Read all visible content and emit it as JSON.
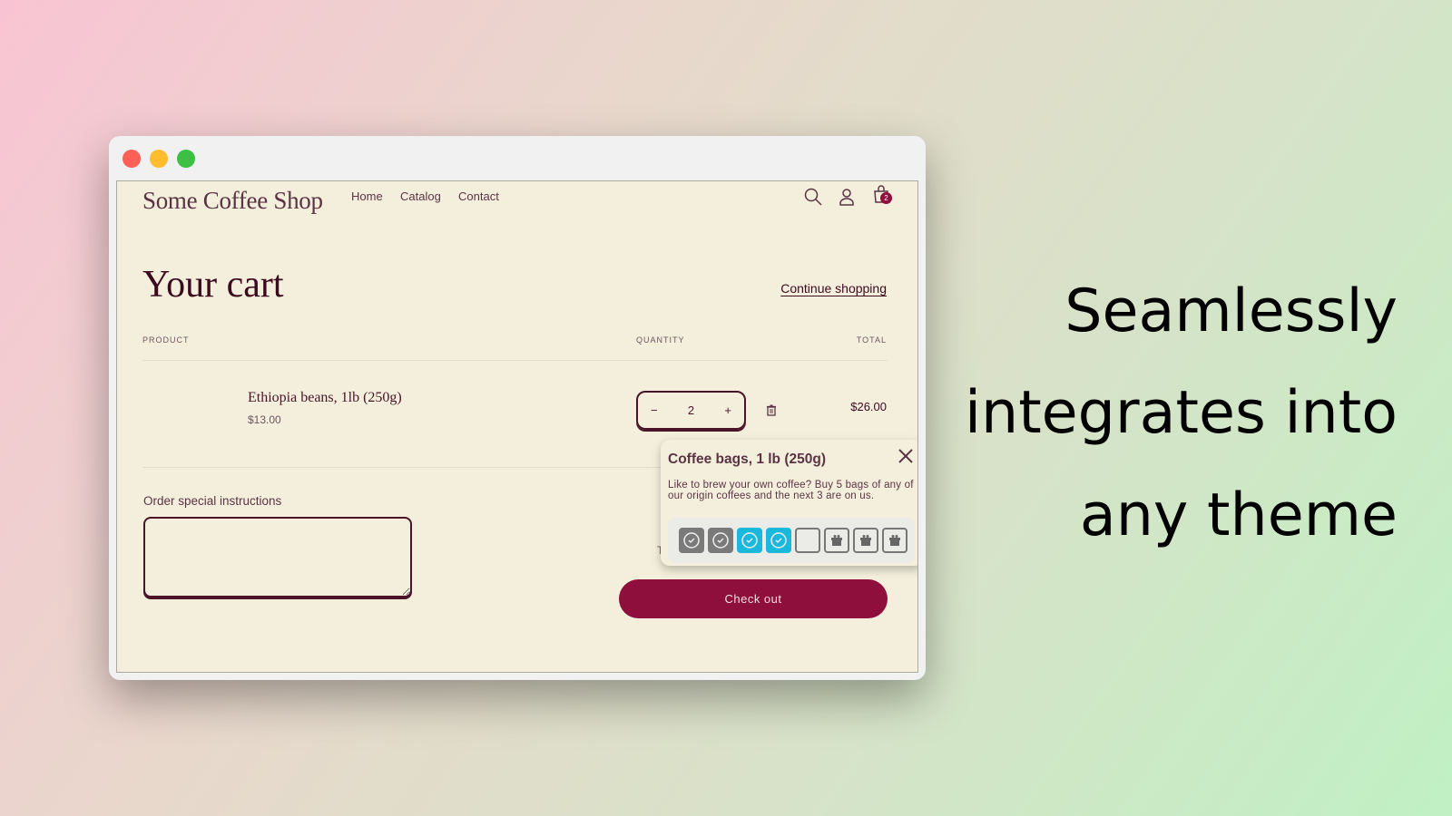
{
  "window": {
    "controls": [
      "close",
      "minimize",
      "maximize"
    ],
    "colors": {
      "close": "#fe5f57",
      "minimize": "#febc2e",
      "maximize": "#3dbf44"
    }
  },
  "header": {
    "logo": "Some Coffee Shop",
    "nav": [
      "Home",
      "Catalog",
      "Contact"
    ],
    "cart_count": "2",
    "icons": [
      "search-icon",
      "account-icon",
      "cart-icon"
    ]
  },
  "cart": {
    "title": "Your cart",
    "continue": "Continue shopping",
    "columns": {
      "product": "PRODUCT",
      "quantity": "QUANTITY",
      "total": "TOTAL"
    },
    "item": {
      "name": "Ethiopia beans, 1lb (250g)",
      "price": "$13.00",
      "quantity": "2",
      "total": "$26.00",
      "minus": "−",
      "plus": "+"
    },
    "instructions_label": "Order special instructions",
    "instructions_value": "",
    "subtotal_partial": "T",
    "checkout": "Check out"
  },
  "popup": {
    "title": "Coffee bags, 1 lb (250g)",
    "text": "Like to brew your own coffee? Buy 5 bags of any of our origin coffees and the next 3 are on us.",
    "slots": [
      "filled",
      "filled",
      "added",
      "added",
      "empty",
      "gift",
      "gift",
      "gift"
    ]
  },
  "colors": {
    "accent": "#8e0e3c",
    "added": "#1ab8da",
    "filled": "#7a7a7a"
  },
  "tagline": [
    "Seamlessly",
    "integrates into",
    "any theme"
  ]
}
